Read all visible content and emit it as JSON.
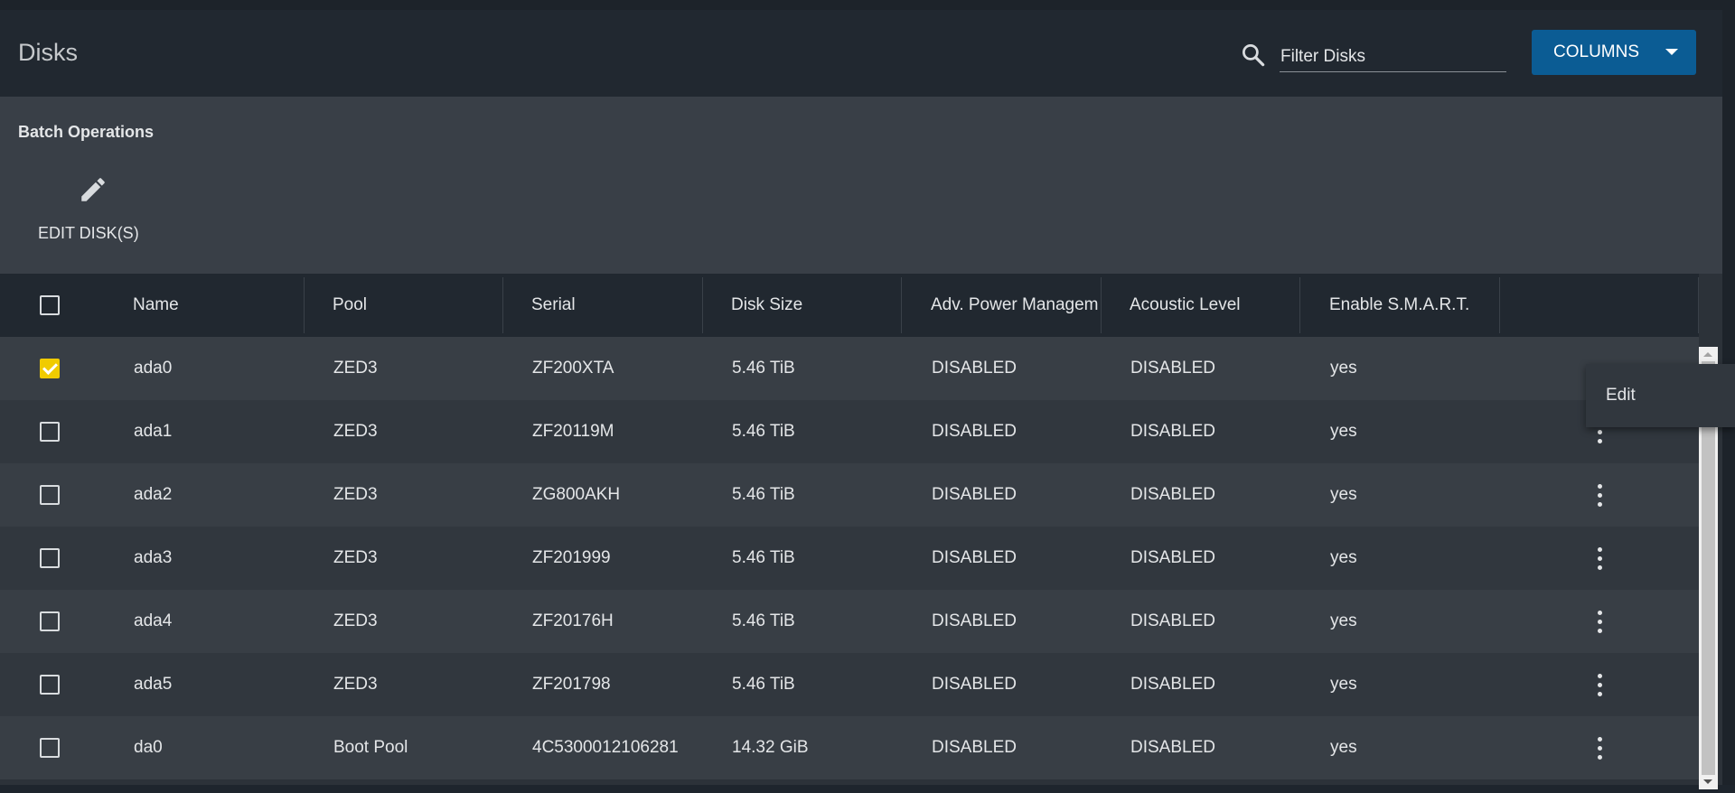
{
  "header": {
    "title": "Disks",
    "filter_placeholder": "Filter Disks",
    "filter_value": "",
    "columns_label": "COLUMNS"
  },
  "batch": {
    "title": "Batch Operations",
    "edit_label": "EDIT DISK(S)"
  },
  "table": {
    "columns": [
      "Name",
      "Pool",
      "Serial",
      "Disk Size",
      "Adv. Power Managem",
      "Acoustic Level",
      "Enable S.M.A.R.T."
    ],
    "rows": [
      {
        "checked": true,
        "name": "ada0",
        "pool": "ZED3",
        "serial": "ZF200XTA",
        "size": "5.46 TiB",
        "apm": "DISABLED",
        "acoustic": "DISABLED",
        "smart": "yes"
      },
      {
        "checked": false,
        "name": "ada1",
        "pool": "ZED3",
        "serial": "ZF20119M",
        "size": "5.46 TiB",
        "apm": "DISABLED",
        "acoustic": "DISABLED",
        "smart": "yes"
      },
      {
        "checked": false,
        "name": "ada2",
        "pool": "ZED3",
        "serial": "ZG800AKH",
        "size": "5.46 TiB",
        "apm": "DISABLED",
        "acoustic": "DISABLED",
        "smart": "yes"
      },
      {
        "checked": false,
        "name": "ada3",
        "pool": "ZED3",
        "serial": "ZF201999",
        "size": "5.46 TiB",
        "apm": "DISABLED",
        "acoustic": "DISABLED",
        "smart": "yes"
      },
      {
        "checked": false,
        "name": "ada4",
        "pool": "ZED3",
        "serial": "ZF20176H",
        "size": "5.46 TiB",
        "apm": "DISABLED",
        "acoustic": "DISABLED",
        "smart": "yes"
      },
      {
        "checked": false,
        "name": "ada5",
        "pool": "ZED3",
        "serial": "ZF201798",
        "size": "5.46 TiB",
        "apm": "DISABLED",
        "acoustic": "DISABLED",
        "smart": "yes"
      },
      {
        "checked": false,
        "name": "da0",
        "pool": "Boot Pool",
        "serial": "4C5300012106281",
        "size": "14.32 GiB",
        "apm": "DISABLED",
        "acoustic": "DISABLED",
        "smart": "yes"
      }
    ]
  },
  "row_menu": {
    "items": [
      "Edit"
    ]
  },
  "icons": {
    "search": "search-icon",
    "edit": "pencil-icon",
    "row_actions": "more-vert-icon",
    "dropdown": "caret-down-icon"
  },
  "colors": {
    "accent": "#0b5c94",
    "checkbox_checked": "#f0cb00"
  }
}
